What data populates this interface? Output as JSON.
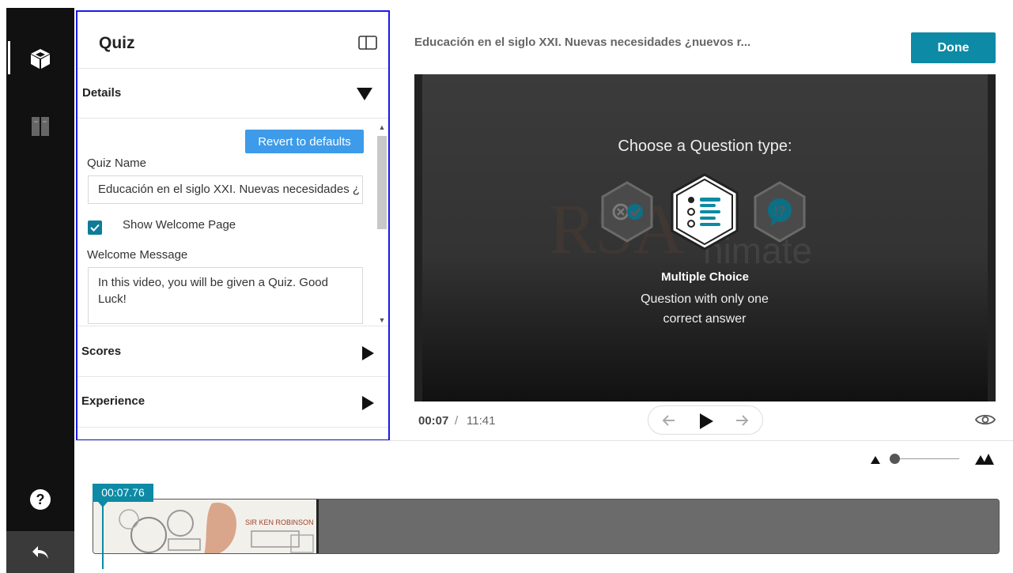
{
  "sidebar": {
    "icons": [
      "cube-icon",
      "book-icon",
      "help-icon",
      "undo-icon"
    ]
  },
  "quiz_panel": {
    "title": "Quiz",
    "sections": {
      "details": {
        "label": "Details",
        "expanded": true
      },
      "scores": {
        "label": "Scores",
        "expanded": false
      },
      "experience": {
        "label": "Experience",
        "expanded": false
      }
    },
    "revert_label": "Revert to defaults",
    "quiz_name_label": "Quiz Name",
    "quiz_name_value": "Educación en el siglo XXI. Nuevas necesidades ¿",
    "show_welcome_label": "Show Welcome Page",
    "show_welcome_checked": true,
    "welcome_message_label": "Welcome Message",
    "welcome_message_value": "In this video, you will be given a Quiz. Good Luck!"
  },
  "header": {
    "video_title": "Educación en el siglo XXI. Nuevas necesidades ¿nuevos r...",
    "done_label": "Done"
  },
  "video": {
    "prompt": "Choose a Question type:",
    "watermark_main": "RSA",
    "watermark_sub": "nimate",
    "question_types": [
      {
        "icon": "true-false-icon",
        "selected": false
      },
      {
        "icon": "multiple-choice-icon",
        "selected": true
      },
      {
        "icon": "open-question-icon",
        "selected": false
      }
    ],
    "selected_type_name": "Multiple Choice",
    "selected_type_desc": "Question with only one correct answer"
  },
  "player": {
    "current_time": "00:07",
    "separator": "/",
    "total_time": "11:41"
  },
  "timeline": {
    "playhead_label": "00:07.76",
    "thumbnail_caption": "SIR KEN ROBINSON"
  },
  "colors": {
    "accent": "#0d8aa5",
    "revert_button": "#3d9be9",
    "panel_border": "#1a1ae6",
    "sidebar_bg": "#111111"
  }
}
